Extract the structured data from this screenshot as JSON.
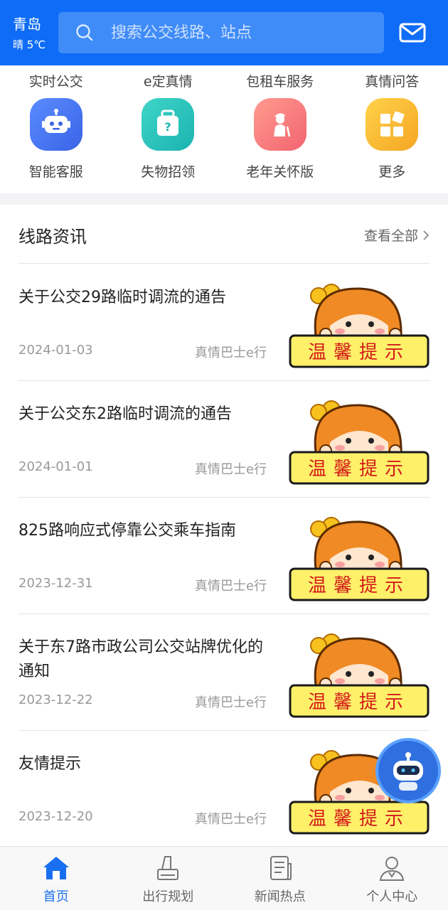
{
  "header": {
    "city": "青岛",
    "weather": "晴 5℃",
    "search_placeholder": "搜索公交线路、站点"
  },
  "top_tabs": [
    "实时公交",
    "e定真情",
    "包租车服务",
    "真情问答"
  ],
  "features": [
    {
      "label": "智能客服",
      "icon": "robot-icon"
    },
    {
      "label": "失物招领",
      "icon": "luggage-icon"
    },
    {
      "label": "老年关怀版",
      "icon": "elder-icon"
    },
    {
      "label": "更多",
      "icon": "more-apps-icon"
    }
  ],
  "section": {
    "title": "线路资讯",
    "see_all": "查看全部"
  },
  "news": [
    {
      "title": "关于公交29路临时调流的通告",
      "date": "2024-01-03",
      "source": "真情巴士e行",
      "thumb_text": "温馨提示"
    },
    {
      "title": "关于公交东2路临时调流的通告",
      "date": "2024-01-01",
      "source": "真情巴士e行",
      "thumb_text": "温馨提示"
    },
    {
      "title": "825路响应式停靠公交乘车指南",
      "date": "2023-12-31",
      "source": "真情巴士e行",
      "thumb_text": "温馨提示"
    },
    {
      "title": "关于东7路市政公司公交站牌优化的通知",
      "date": "2023-12-22",
      "source": "真情巴士e行",
      "thumb_text": "温馨提示"
    },
    {
      "title": "友情提示",
      "date": "2023-12-20",
      "source": "真情巴士e行",
      "thumb_text": "温馨提示"
    }
  ],
  "bottom_nav": [
    {
      "label": "首页",
      "icon": "home-icon",
      "active": true
    },
    {
      "label": "出行规划",
      "icon": "trip-plan-icon",
      "active": false
    },
    {
      "label": "新闻热点",
      "icon": "news-icon",
      "active": false
    },
    {
      "label": "个人中心",
      "icon": "profile-icon",
      "active": false
    }
  ],
  "colors": {
    "brand_blue": "#0f6cf6",
    "active_nav": "#1a6ff0"
  }
}
